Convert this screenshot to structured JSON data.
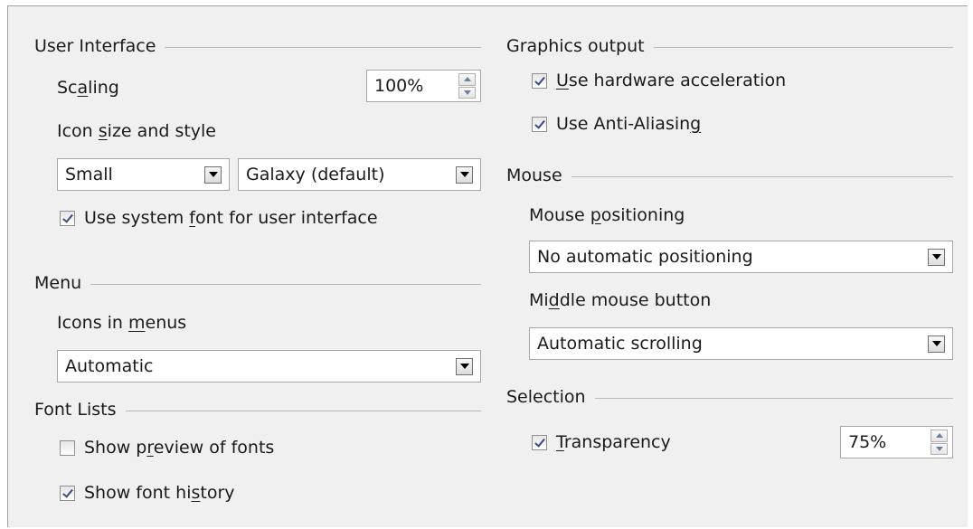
{
  "user_interface": {
    "heading": "User Interface",
    "scaling_label_pre": "Sc",
    "scaling_label_key": "a",
    "scaling_label_post": "ling",
    "scaling_value": "100%",
    "icon_size_label_pre": "Icon ",
    "icon_size_label_key": "s",
    "icon_size_label_post": "ize and style",
    "icon_size_value": "Small",
    "icon_style_value": "Galaxy (default)",
    "system_font_pre": "Use system ",
    "system_font_key": "f",
    "system_font_post": "ont for user interface",
    "system_font_checked": true
  },
  "menu": {
    "heading": "Menu",
    "icons_label_pre": "Icons in ",
    "icons_label_key": "m",
    "icons_label_post": "enus",
    "icons_value": "Automatic"
  },
  "font_lists": {
    "heading": "Font Lists",
    "preview_pre": "Show p",
    "preview_key": "r",
    "preview_post": "eview of fonts",
    "preview_checked": false,
    "history_pre": "Show font hi",
    "history_key": "s",
    "history_post": "tory",
    "history_checked": true
  },
  "graphics_output": {
    "heading": "Graphics output",
    "hw_accel_pre": "",
    "hw_accel_key": "U",
    "hw_accel_post": "se hardware acceleration",
    "hw_accel_checked": true,
    "aa_pre": "Use Anti-Aliasin",
    "aa_key": "g",
    "aa_post": "",
    "aa_checked": true
  },
  "mouse": {
    "heading": "Mouse",
    "positioning_pre": "Mouse ",
    "positioning_key": "p",
    "positioning_post": "ositioning",
    "positioning_value": "No automatic positioning",
    "middle_pre": "Mi",
    "middle_key": "d",
    "middle_post": "dle mouse button",
    "middle_value": "Automatic scrolling"
  },
  "selection": {
    "heading": "Selection",
    "transparency_pre": "",
    "transparency_key": "T",
    "transparency_post": "ransparency",
    "transparency_checked": true,
    "transparency_value": "75%"
  }
}
